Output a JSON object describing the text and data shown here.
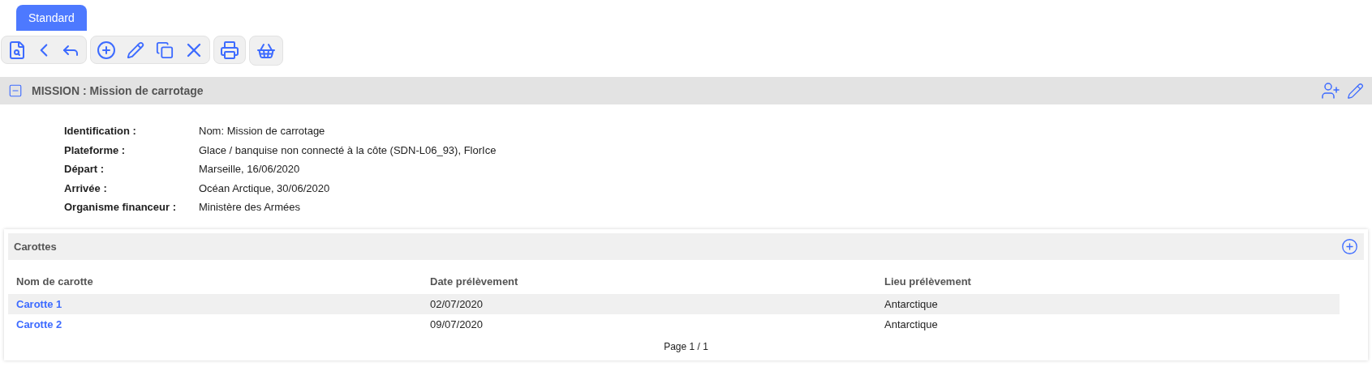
{
  "tabs": [
    {
      "label": "Standard",
      "selected": true
    }
  ],
  "section": {
    "title": "MISSION : Mission de carrotage",
    "expanded": true
  },
  "details": [
    {
      "label": "Identification :",
      "value": "Nom: Mission de carrotage"
    },
    {
      "label": "Plateforme :",
      "value": "Glace / banquise non connecté à la côte (SDN-L06_93), FlorIce"
    },
    {
      "label": "Départ :",
      "value": "Marseille, 16/06/2020"
    },
    {
      "label": "Arrivée :",
      "value": "Océan Arctique, 30/06/2020"
    },
    {
      "label": "Organisme financeur :",
      "value": "Ministère des Armées"
    }
  ],
  "carottes": {
    "title": "Carottes",
    "columns": [
      "Nom de carotte",
      "Date prélèvement",
      "Lieu prélèvement"
    ],
    "rows": [
      [
        "Carotte 1",
        "02/07/2020",
        "Antarctique"
      ],
      [
        "Carotte 2",
        "09/07/2020",
        "Antarctique"
      ]
    ],
    "pagination": "Page 1 / 1"
  }
}
